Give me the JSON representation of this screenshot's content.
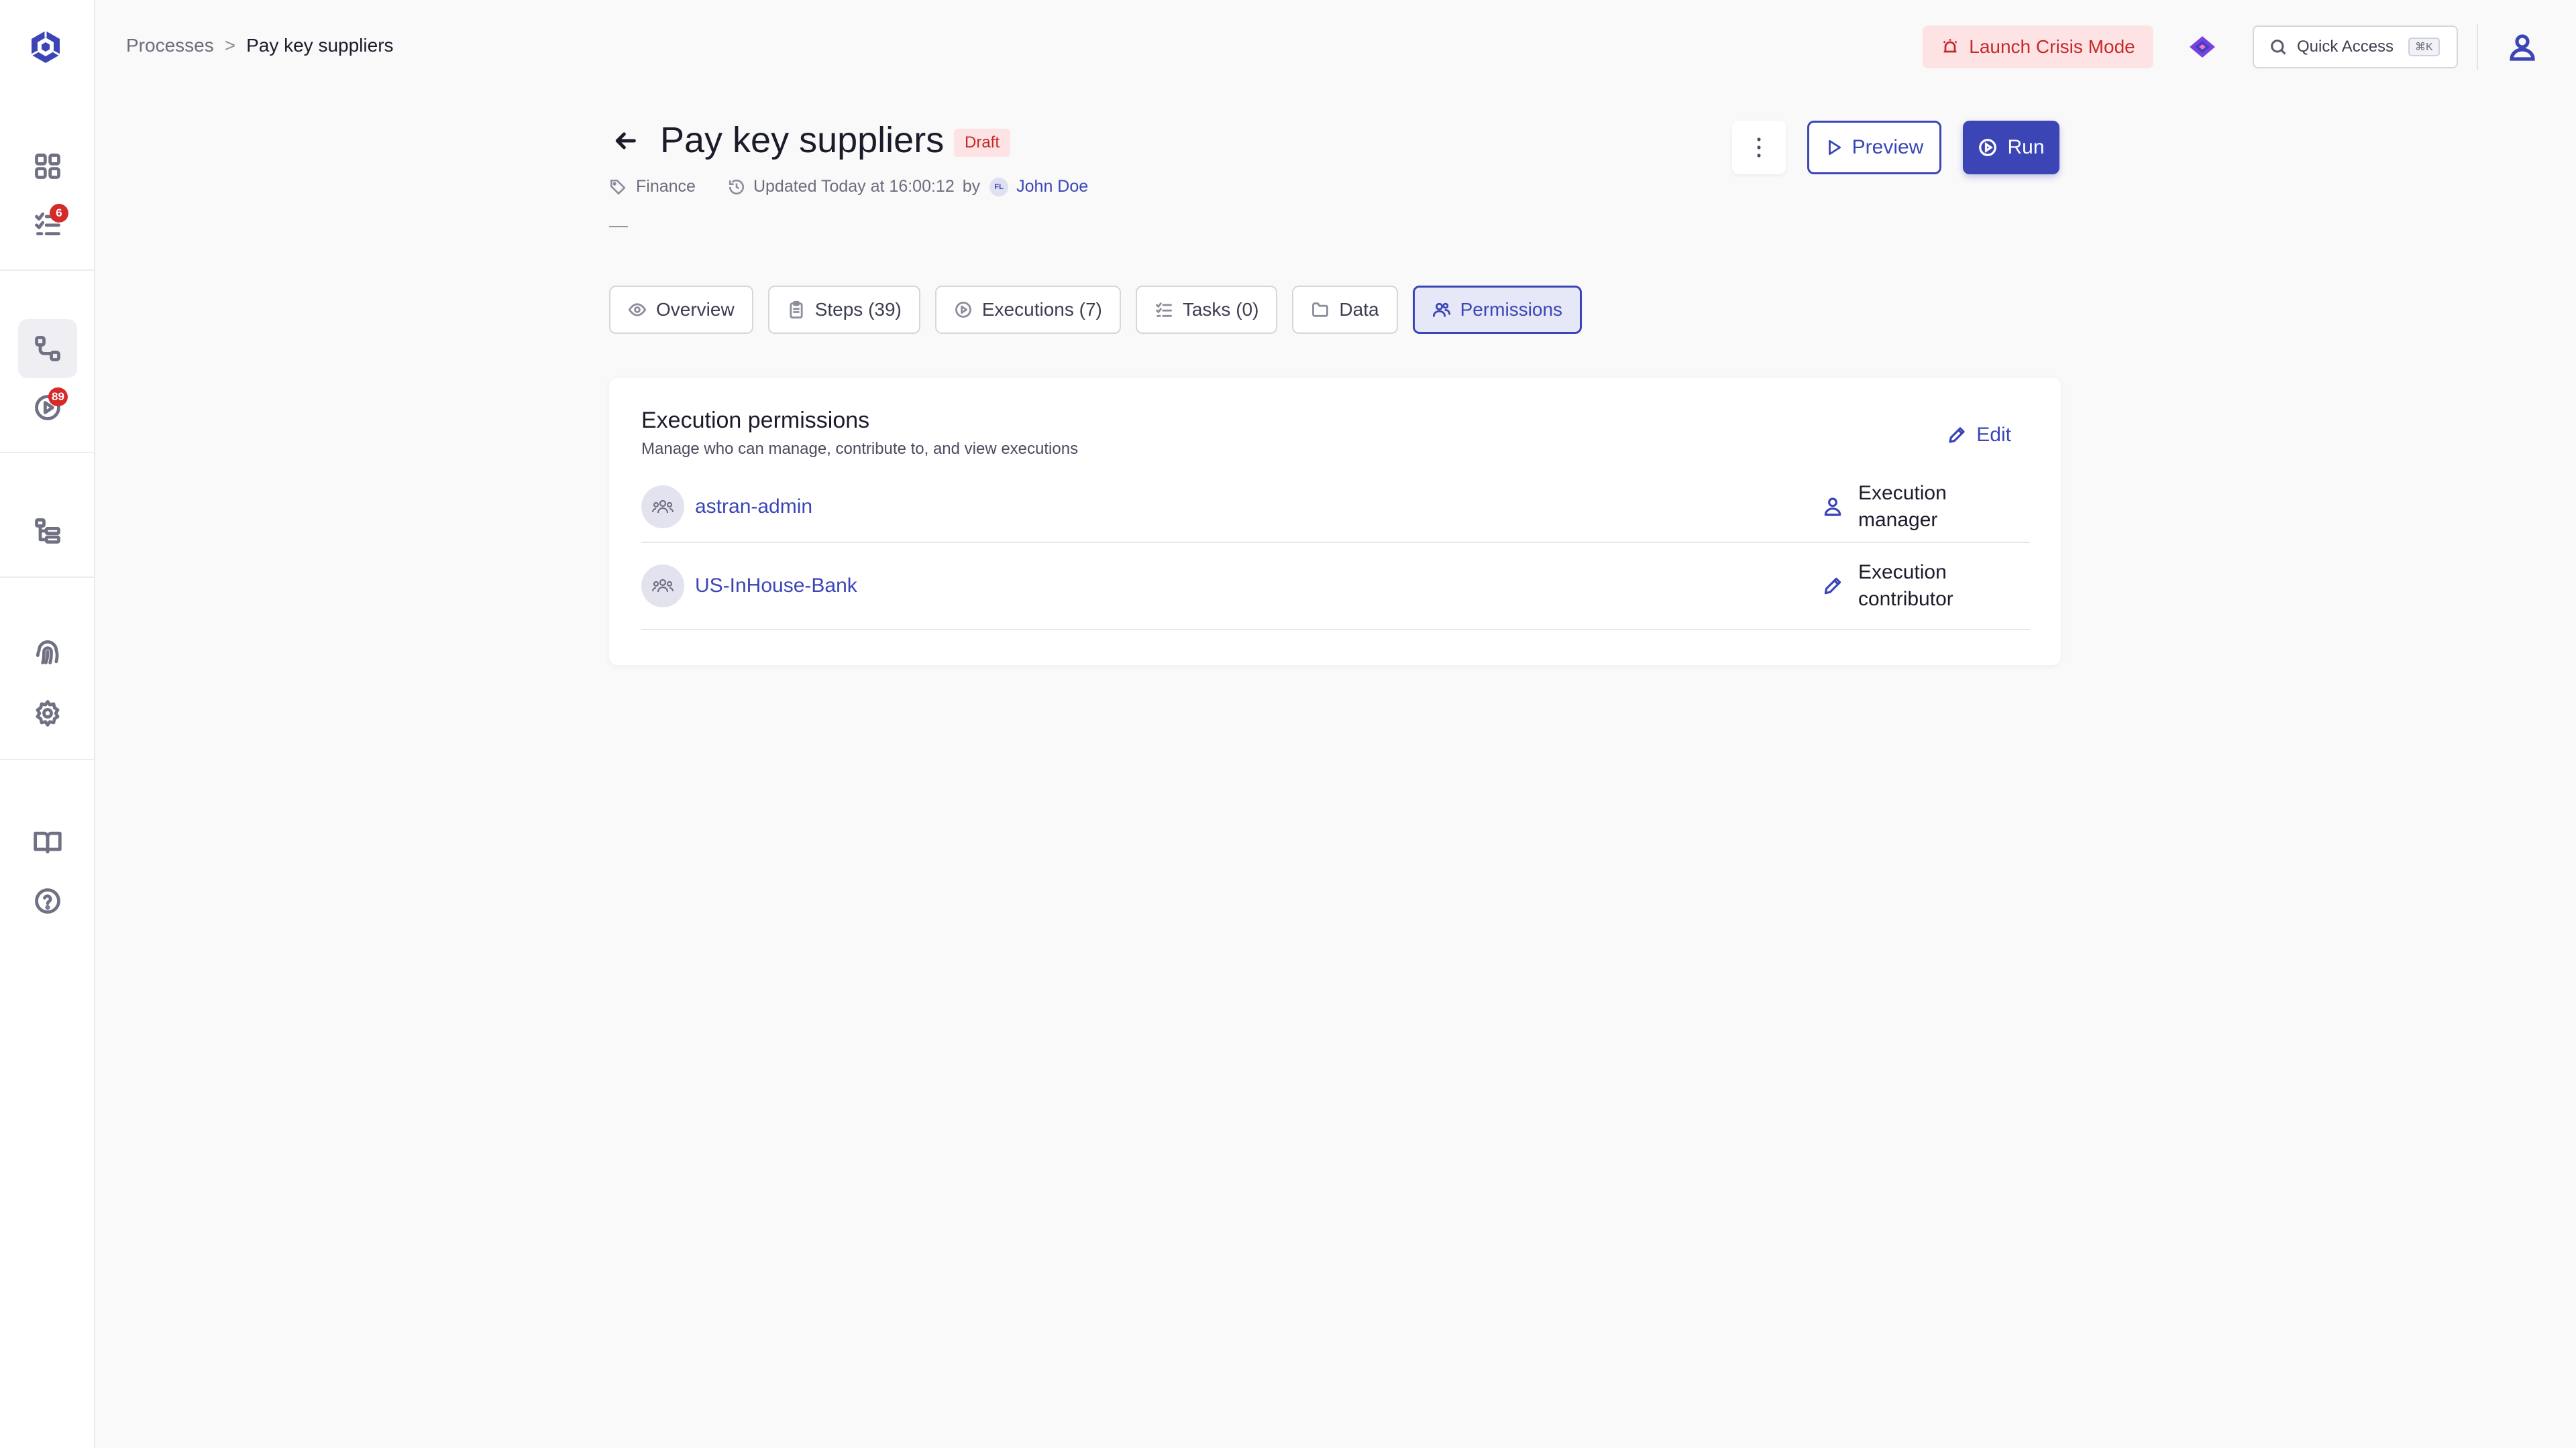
{
  "breadcrumb": {
    "parent": "Processes",
    "separator": ">",
    "current": "Pay key suppliers"
  },
  "sidebar": {
    "badges": {
      "tasks": "6",
      "executions": "89"
    },
    "items": [
      {
        "name": "dashboard-icon"
      },
      {
        "name": "tasks-icon"
      },
      {
        "name": "processes-icon",
        "active": true
      },
      {
        "name": "executions-icon"
      },
      {
        "name": "structure-icon"
      },
      {
        "name": "fingerprint-icon"
      },
      {
        "name": "settings-icon"
      },
      {
        "name": "book-icon"
      },
      {
        "name": "help-icon"
      }
    ]
  },
  "topbar": {
    "crisis_label": "Launch Crisis Mode",
    "quick_access_label": "Quick Access",
    "quick_access_shortcut": "⌘K"
  },
  "process": {
    "title": "Pay key suppliers",
    "status": "Draft",
    "category": "Finance",
    "updated": "Updated Today at 16:00:12",
    "by": "by",
    "author_initials": "FL",
    "author": "John Doe",
    "description": "—"
  },
  "actions": {
    "preview": "Preview",
    "run": "Run"
  },
  "tabs": [
    {
      "label": "Overview",
      "icon": "eye-icon"
    },
    {
      "label": "Steps (39)",
      "icon": "clipboard-icon"
    },
    {
      "label": "Executions (7)",
      "icon": "play-circle-icon"
    },
    {
      "label": "Tasks (0)",
      "icon": "list-check-icon"
    },
    {
      "label": "Data",
      "icon": "folder-icon"
    },
    {
      "label": "Permissions",
      "icon": "users-icon",
      "active": true
    }
  ],
  "permissions": {
    "title": "Execution permissions",
    "subtitle": "Manage who can manage, contribute to, and view executions",
    "edit_label": "Edit",
    "rows": [
      {
        "name": "astran-admin",
        "role": "Execution manager",
        "role_icon": "user-manager-icon"
      },
      {
        "name": "US-InHouse-Bank",
        "role": "Execution contributor",
        "role_icon": "pencil-icon"
      }
    ]
  },
  "colors": {
    "accent": "#3b45b6",
    "danger": "#c7282a",
    "danger_bg": "#fde3e3",
    "badge": "#d62929"
  }
}
